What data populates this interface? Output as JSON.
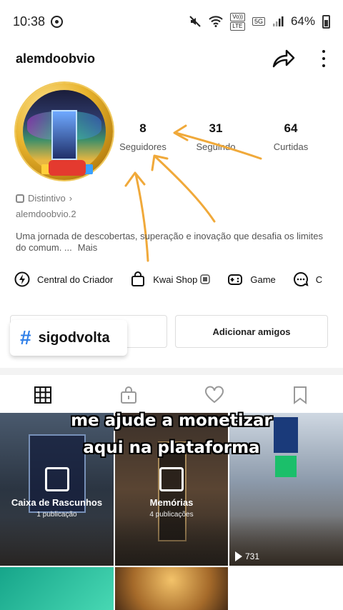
{
  "status_bar": {
    "time": "10:38",
    "network_tag_top": "Vo))",
    "network_tag_bottom": "LTE",
    "network_5g": "5G",
    "battery": "64%"
  },
  "profile": {
    "username": "alemdoobvio",
    "handle": "alemdoobvio.2",
    "badge_label": "Distintivo",
    "bio": "Uma jornada de descobertas, superação e inovação que desafia os limites do comum. ...",
    "bio_more": "Mais"
  },
  "stats": [
    {
      "value": "8",
      "label": "Seguidores"
    },
    {
      "value": "31",
      "label": "Seguindo"
    },
    {
      "value": "64",
      "label": "Curtidas"
    }
  ],
  "shortcuts": [
    {
      "label": "Central do Criador",
      "icon": "bolt-circle-icon"
    },
    {
      "label": "Kwai Shop",
      "icon": "shopping-bag-icon"
    },
    {
      "label": "Game",
      "icon": "gamepad-icon"
    },
    {
      "label": "C",
      "icon": "chat-bubble-icon"
    }
  ],
  "buttons": {
    "add_friends": "Adicionar amigos",
    "hashtag_symbol": "#",
    "hashtag_label": "sigodvolta"
  },
  "tabs": [
    {
      "name": "grid",
      "icon": "grid-icon"
    },
    {
      "name": "private",
      "icon": "lock-bag-icon"
    },
    {
      "name": "likes",
      "icon": "heart-icon"
    },
    {
      "name": "saved",
      "icon": "bookmark-icon"
    }
  ],
  "grid": {
    "drafts_title": "Caixa de Rascunhos",
    "drafts_sub": "1 publicação",
    "memories_title": "Memórias",
    "memories_sub": "4 publicações",
    "views": "731"
  },
  "caption": {
    "line1": "me ajude a monetizar",
    "line2": "aqui na plataforma"
  },
  "colors": {
    "arrow": "#f0a93a",
    "hashtag": "#2f7fe8"
  }
}
